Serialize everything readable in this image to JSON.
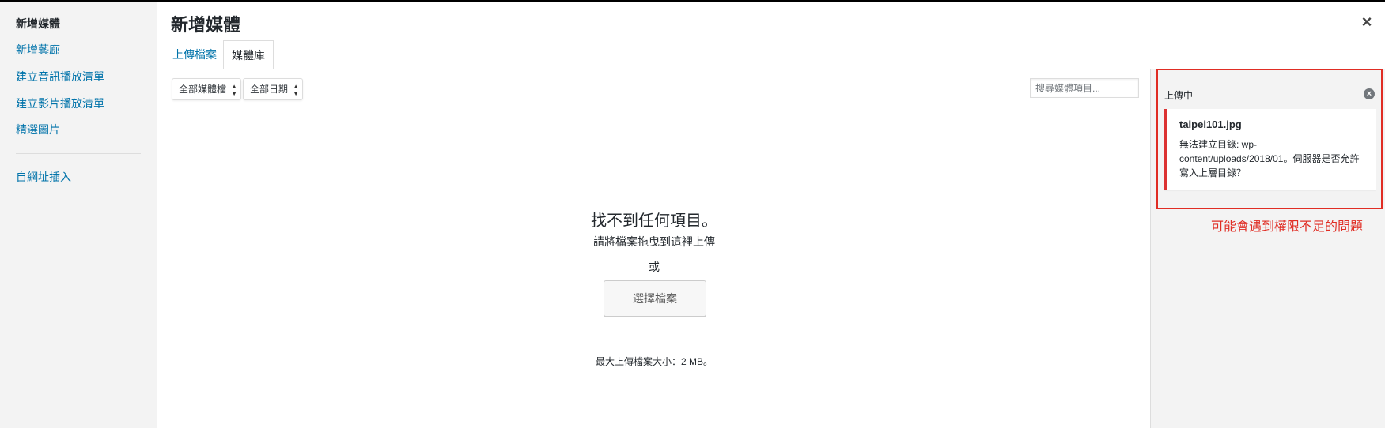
{
  "menu": {
    "items": [
      {
        "label": "新增媒體"
      },
      {
        "label": "新增藝廊"
      },
      {
        "label": "建立音訊播放清單"
      },
      {
        "label": "建立影片播放清單"
      },
      {
        "label": "精選圖片"
      },
      {
        "label": "自網址插入"
      }
    ],
    "active_index": 0
  },
  "frame": {
    "title": "新增媒體",
    "close_icon": "×",
    "tabs": [
      {
        "label": "上傳檔案"
      },
      {
        "label": "媒體庫"
      }
    ],
    "active_tab": 1
  },
  "toolbar": {
    "media_filter": "全部媒體檔",
    "date_filter": "全部日期",
    "search_placeholder": "搜尋媒體項目..."
  },
  "empty_state": {
    "title": "找不到任何項目。",
    "drop_text": "請將檔案拖曳到這裡上傳",
    "or_text": "或",
    "choose_button": "選擇檔案",
    "max_size": "最大上傳檔案大小：2 MB。"
  },
  "upload_panel": {
    "label": "上傳中",
    "dismiss_icon": "×",
    "error": {
      "filename": "taipei101.jpg",
      "message": "無法建立目錄: wp-content/uploads/2018/01。伺服器是否允許寫入上層目錄？"
    }
  },
  "annotation": {
    "text": "可能會遇到權限不足的問題",
    "color": "#e02d24"
  }
}
